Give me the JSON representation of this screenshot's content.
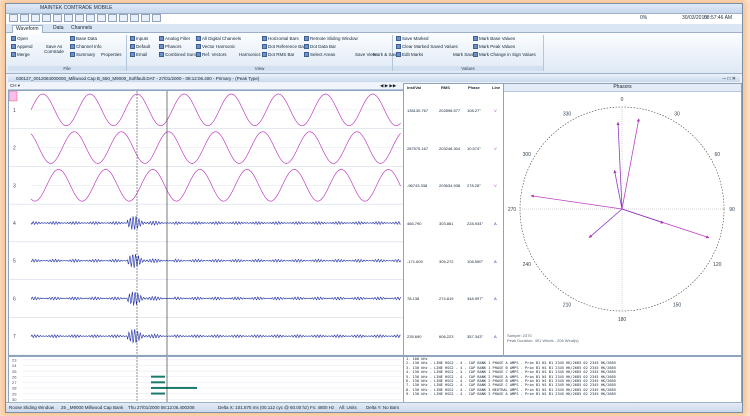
{
  "app": {
    "title": "MAINTEK COMTRADE MOBILE",
    "percent": "0%",
    "date": "30/03/2015",
    "time": "08:57:46 AM"
  },
  "tabs": [
    "Waveform",
    "Data",
    "Channels"
  ],
  "ribbon": {
    "file": {
      "label": "File",
      "items": [
        "Open",
        "Append",
        "Merge",
        "Save As Comtrade",
        "Base Data",
        "Channel Info",
        "Summary",
        "Properties"
      ]
    },
    "view": {
      "label": "View",
      "items": [
        "Inputs",
        "Default",
        "Email",
        "Analog Filter",
        "Phasors",
        "Combined Sum",
        "All Digital Channels",
        "Vector Harmonic",
        "Ref. Vectors",
        "Harmonics",
        "Horizontal Bars",
        "Dot Reference Bar",
        "Dot RMS Bar",
        "Remote Sliding Window",
        "Dot Data Bar",
        "Select Areas",
        "Save View",
        "Mark & Save"
      ]
    },
    "values": {
      "label": "Values",
      "items": [
        "Save Marked",
        "Clear Marked Saved Values",
        "Edit Marks",
        "Mark Save",
        "Mark Base Values",
        "Mark Peak Values",
        "Mark Change in Sign Values"
      ]
    }
  },
  "document": {
    "title": "030127_0012084000000_Millwood Cap B_550_M9000_Softfault.DAT - 27/01/2000 - 08:12:06.400 - Primary - (Peak Type)",
    "phasors_title": "Phasors"
  },
  "channels": [
    "1",
    "2",
    "3",
    "4",
    "5",
    "6",
    "7"
  ],
  "channel_table": {
    "headers": [
      "Inst/Val",
      "RMS",
      "Phase",
      "Line"
    ],
    "rows": [
      {
        "inst": "136130.767",
        "rms": "202898.577",
        "phase": "108.27°",
        "unit": "V"
      },
      {
        "inst": "287575.167",
        "rms": "203248.304",
        "phase": "10.574°",
        "unit": "V"
      },
      {
        "inst": "-96743.338",
        "rms": "203634.938",
        "phase": "278.28°",
        "unit": "V"
      },
      {
        "inst": "466.790",
        "rms": "303.861",
        "phase": "228.934°",
        "unit": "A"
      },
      {
        "inst": "-171.600",
        "rms": "305.272",
        "phase": "108.590°",
        "unit": "A"
      },
      {
        "inst": "78.138",
        "rms": "274.819",
        "phase": "348.997°",
        "unit": "A"
      },
      {
        "inst": "235.690",
        "rms": "606.223",
        "phase": "357.343°",
        "unit": "A"
      }
    ]
  },
  "phasor_labels": [
    "0",
    "30",
    "60",
    "90",
    "120",
    "150",
    "180",
    "210",
    "240",
    "270",
    "300",
    "330"
  ],
  "phasor_footer": [
    "Sample: 2370",
    "Peak Duration: 491 Winds - 206 Wind(s)"
  ],
  "digital_rows": [
    "23",
    "24",
    "25",
    "26",
    "27",
    "28",
    "29",
    "30"
  ],
  "digital_list": [
    "1. 100 kHz",
    "2. 130 kHz   - LINE HSG2 - 4 - CAP BANK 1 PHASE A AMPS - Prim   B1   N1   B1 2345 HK/2685   02 2345 HK/2685",
    "3. 130 kHz   - LINE HSG2 - 4 - CAP BANK 1 PHASE B AMPS - Prim   B1   N1   B1 2345 HK/2685   02 2345 HK/2685",
    "4. 130 kHz   - LINE HSG2 - 4 - CAP BANK 1 PHASE C AMPS - Prim   B1   N1   B1 2345 HK/2685   02 2345 HK/2685",
    "5. 130 kHz   - LINE HSG2 - 4 - CAP BANK 2 PHASE A AMPS - Prim   B1   N1   B1 2345 HK/2685   02 2345 HK/2685",
    "6. 130 kHz   - LINE HSG2 - 4 - CAP BANK 2 PHASE B AMPS - Prim   B1   N1   B1 2345 HK/2685   02 2345 HK/2685",
    "7. 130 kHz   - LINE HSG2 - 4 - CAP BANK 2 PHASE C AMPS - Prim   B1   N1   B1 2345 HK/2685   02 2345 HK/2685",
    "8. 130 kHz   - LINE HSG2 - 4 - CAP BANK 3 NEUTRAL AMPS - Prim   B1   N1   B1 2345 HK/2685   02 2345 HK/2685",
    "9. 130 kHz   - LINE HSG2 - 4 - CAP BANK 3 PHASE A AMPS - Prim   B1   N1   B1 2345 HK/2685   02 2345 HK/2685"
  ],
  "status": {
    "window": "Roose Sliding Window",
    "file": "25 _M9000 Millwood Cap Bank",
    "time": "Thu    27/01/2000 08:12:06.400208",
    "delta": "Delta X: 101.875 ms (00.112 cyc @ 60.00 hz) Fs: 4800 Hz",
    "units": "All: Units",
    "deltay": "Delta Y: No Bars"
  },
  "colors": {
    "voltage": "#c040c0",
    "current": "#1a2aa8",
    "digital": "#1a7a6a"
  }
}
